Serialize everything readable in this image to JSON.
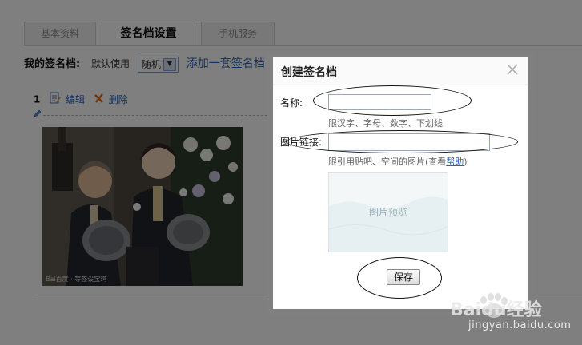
{
  "tabs": [
    {
      "label": "基本资料",
      "active": false
    },
    {
      "label": "签名档设置",
      "active": true
    },
    {
      "label": "手机服务",
      "active": false
    }
  ],
  "signature": {
    "label": "我的签名档:",
    "default_use": "默认使用",
    "select_value": "随机",
    "add_link": "添加一套签名档"
  },
  "item": {
    "number": "1",
    "edit_label": "编辑",
    "delete_label": "删除"
  },
  "photo": {
    "watermark": "Bai百度 · 等签设宝鸡"
  },
  "dialog": {
    "title": "创建签名档",
    "name_label": "名称:",
    "name_value": "",
    "name_hint": "限汉字、字母、数字、下划线",
    "image_label": "图片链接:",
    "image_value": "",
    "image_hint_prefix": "限引用贴吧、空间的图片(查看",
    "image_hint_link": "帮助",
    "image_hint_suffix": ")",
    "preview_text": "图片预览",
    "save_label": "保存"
  },
  "watermark": {
    "brand": "Baidu经验",
    "url": "jingyan.baidu.com"
  },
  "colors": {
    "link": "#2b5fb4",
    "overlay": "#000000",
    "dialog_border": "#808080"
  }
}
